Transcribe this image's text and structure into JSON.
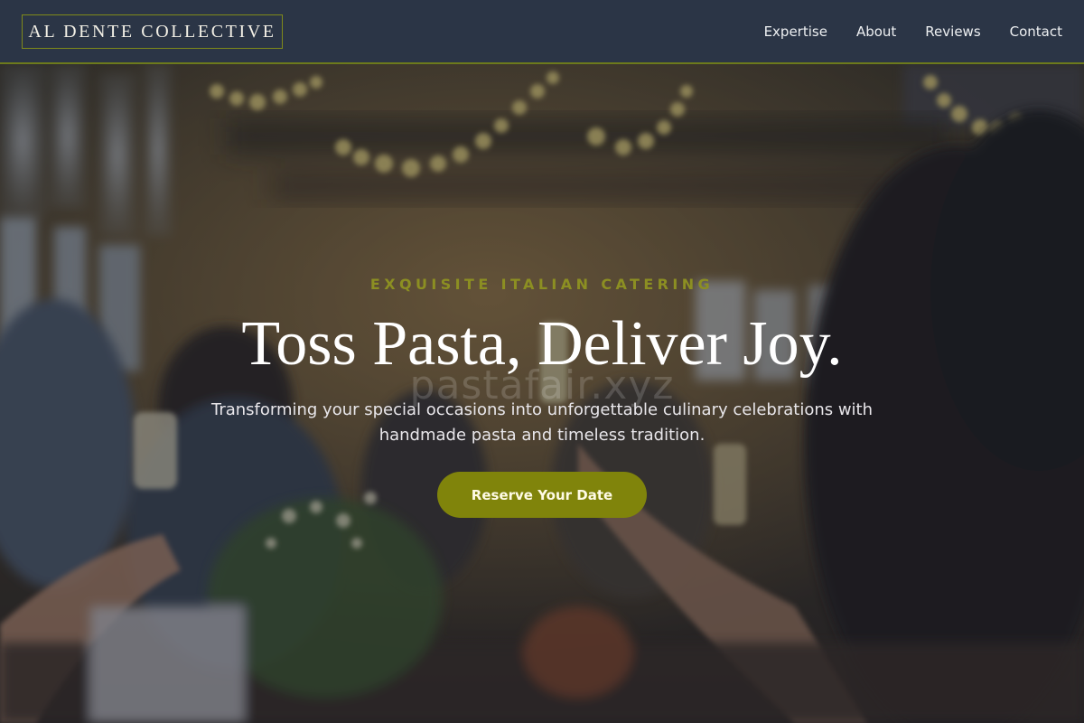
{
  "brand": {
    "name": "AL DENTE COLLECTIVE"
  },
  "nav": {
    "items": [
      {
        "label": "Expertise"
      },
      {
        "label": "About"
      },
      {
        "label": "Reviews"
      },
      {
        "label": "Contact"
      }
    ]
  },
  "hero": {
    "eyebrow": "EXQUISITE ITALIAN CATERING",
    "headline": "Toss Pasta, Deliver Joy.",
    "watermark": "pastafair.xyz",
    "subtitle": "Transforming your special occasions into unforgettable culinary celebrations with handmade pasta and timeless tradition.",
    "cta_label": "Reserve Your Date"
  },
  "colors": {
    "nav_background": "#2b3546",
    "accent": "#80840b",
    "eyebrow": "#8c8f22",
    "logo_border": "#7f8a1a"
  }
}
